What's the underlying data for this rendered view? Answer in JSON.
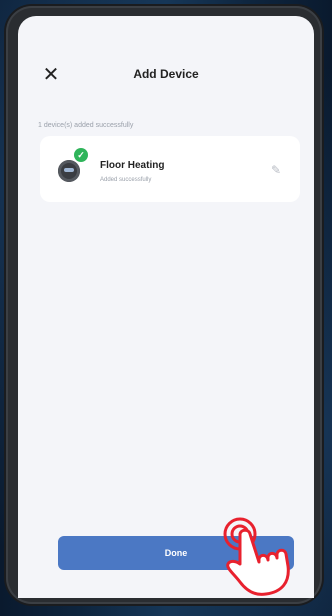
{
  "header": {
    "title": "Add Device",
    "close_icon": "close-icon"
  },
  "caption": "1 device(s) added successfully",
  "device": {
    "name": "Floor Heating",
    "status": "Added successfully",
    "icon": "thermostat-icon",
    "badge_icon": "check-icon",
    "edit_icon": "pencil-icon"
  },
  "done_label": "Done",
  "colors": {
    "accent": "#4b78c4",
    "success": "#2fb45a",
    "background": "#f4f5f9"
  }
}
